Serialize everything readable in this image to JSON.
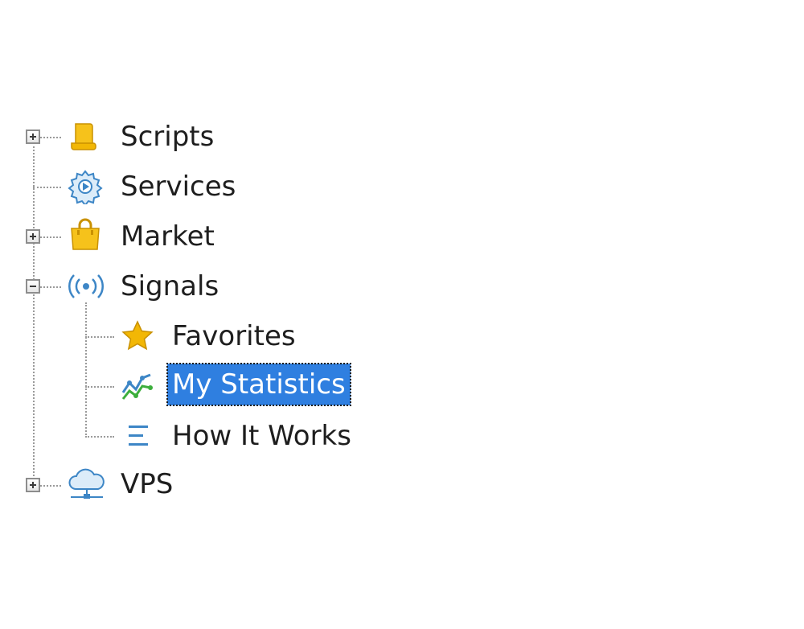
{
  "tree": {
    "items": [
      {
        "label": "Scripts",
        "icon": "scroll-icon",
        "toggle": "expand",
        "level": 0
      },
      {
        "label": "Services",
        "icon": "gear-play-icon",
        "toggle": "none",
        "level": 0
      },
      {
        "label": "Market",
        "icon": "shopping-bag-icon",
        "toggle": "expand",
        "level": 0
      },
      {
        "label": "Signals",
        "icon": "broadcast-icon",
        "toggle": "collapse",
        "level": 0,
        "children": [
          {
            "label": "Favorites",
            "icon": "star-icon",
            "level": 1
          },
          {
            "label": "My Statistics",
            "icon": "statistics-chart-icon",
            "level": 1,
            "selected": true
          },
          {
            "label": "How It Works",
            "icon": "lines-icon",
            "level": 1
          }
        ]
      },
      {
        "label": "VPS",
        "icon": "cloud-network-icon",
        "toggle": "expand",
        "level": 0
      }
    ]
  },
  "colors": {
    "selection_bg": "#2f7fe0",
    "selection_text": "#ffffff",
    "connector": "#9a9a9a",
    "icon_yellow": "#f2b705",
    "icon_blue": "#3d86c6",
    "icon_green": "#3cae3c"
  }
}
